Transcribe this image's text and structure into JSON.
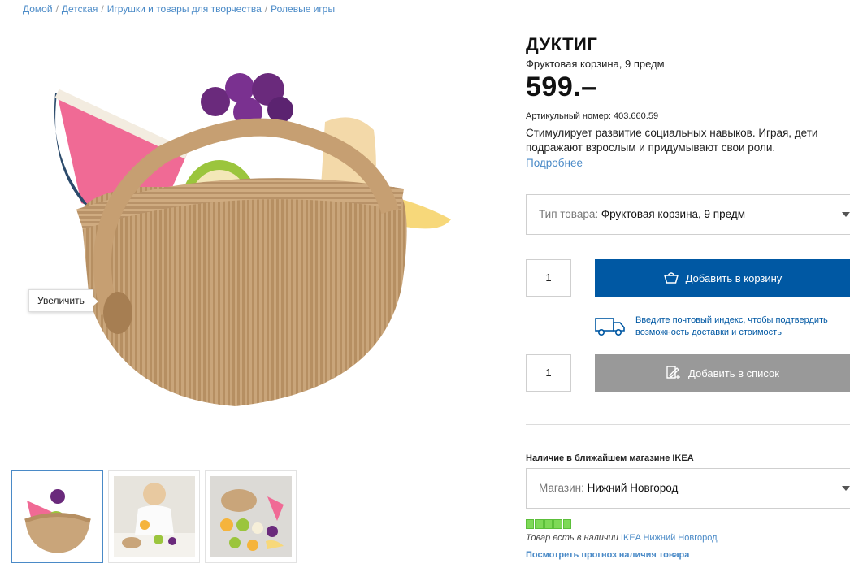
{
  "breadcrumb": [
    "Домой",
    "Детская",
    "Игрушки и товары для творчества",
    "Ролевые игры"
  ],
  "gallery": {
    "zoom_tooltip": "Увеличить"
  },
  "product": {
    "name": "ДУКТИГ",
    "subtitle": "Фруктовая корзина, 9 предм",
    "price": "599.–",
    "article": "Артикульный номер: 403.660.59",
    "description": "Стимулирует развитие социальных навыков. Играя, дети подражают взрослым и придумывают свои роли.",
    "more_link": "Подробнее"
  },
  "type_select": {
    "label": "Тип товара:",
    "value": "Фруктовая корзина, 9 предм"
  },
  "cart": {
    "quantity": "1",
    "button_label": "Добавить в корзину",
    "icon": "basket-icon"
  },
  "delivery": {
    "line1": "Введите почтовый индекс, чтобы подтвердить",
    "line2": "возможность доставки и стоимость",
    "icon": "truck-icon"
  },
  "wishlist": {
    "quantity": "1",
    "button_label": "Добавить в список",
    "icon": "list-add-icon"
  },
  "availability": {
    "title": "Наличие в ближайшем магазине IKEA",
    "store_label": "Магазин:",
    "store_value": "Нижний Новгород",
    "stock_level": 5,
    "stock_max": 5,
    "stock_text": "Товар есть в наличии",
    "store_link": "IKEA Нижний Новгород",
    "forecast_link": "Посмотреть прогноз наличия товара"
  },
  "colors": {
    "primary_blue": "#0058a3",
    "link_blue": "#4a8ac7",
    "stock_green": "#7ed957",
    "secondary_gray": "#999999"
  }
}
